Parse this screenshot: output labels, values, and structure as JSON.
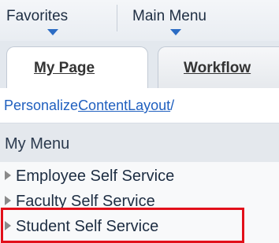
{
  "topnav": {
    "favorites_label": "Favorites",
    "mainmenu_label": "Main Menu"
  },
  "tabs": [
    {
      "label": "My Page",
      "selected": true
    },
    {
      "label": "Workflow",
      "selected": false
    }
  ],
  "personalize": {
    "personalize_label": "Personalize",
    "content_label": "Content",
    "layout_label": "Layout",
    "trailing_label": "/"
  },
  "my_menu": {
    "title": "My Menu",
    "items": [
      {
        "label": "Employee Self Service"
      },
      {
        "label": "Faculty Self Service"
      },
      {
        "label": "Student Self Service",
        "highlighted": true
      }
    ]
  },
  "colors": {
    "link": "#1f5fbf",
    "highlight": "#e2101a",
    "caret": "#2b6cc4"
  }
}
